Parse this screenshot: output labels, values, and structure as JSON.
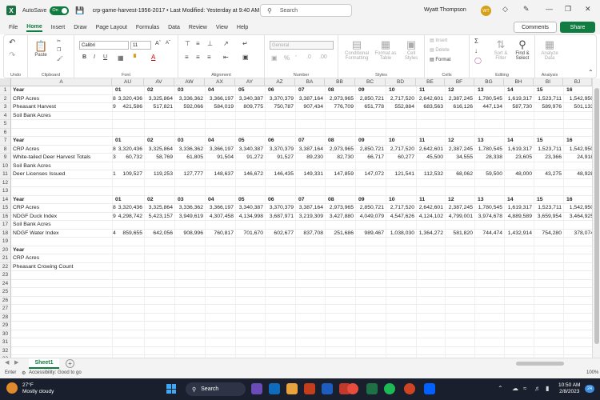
{
  "titlebar": {
    "app_icon": "excel-logo",
    "app_letter": "X",
    "autosave_label": "AutoSave",
    "autosave_state": "On",
    "doc_title": "crp-game-harvest-1956-2017 • Last Modified: Yesterday at 9:40 AM",
    "search_placeholder": "Search",
    "user_name": "Wyatt Thompson",
    "user_initials": "WT"
  },
  "menu_tabs": [
    "File",
    "Home",
    "Insert",
    "Draw",
    "Page Layout",
    "Formulas",
    "Data",
    "Review",
    "View",
    "Help"
  ],
  "active_tab": "Home",
  "comments_label": "Comments",
  "share_label": "Share",
  "ribbon": {
    "groups": [
      "Undo",
      "Clipboard",
      "Font",
      "Alignment",
      "Number",
      "Styles",
      "Cells",
      "Editing",
      "Analysis"
    ],
    "paste_label": "Paste",
    "font_name": "Calibri",
    "font_size": "11",
    "number_format": "General",
    "cond_format_label": "Conditional Formatting",
    "format_table_label": "Format as Table",
    "cell_styles_label": "Cell Styles",
    "insert_label": "Insert",
    "delete_label": "Delete",
    "format_label": "Format",
    "sort_filter_label": "Sort & Filter",
    "find_select_label": "Find & Select",
    "analyze_label": "Analyze Data"
  },
  "sheet": {
    "columns": [
      "A",
      "AU",
      "AV",
      "AW",
      "AX",
      "AY",
      "AZ",
      "BA",
      "BB",
      "BC",
      "BD",
      "BE",
      "BF",
      "BG",
      "BH",
      "BI",
      "BJ"
    ],
    "row_numbers": [
      "1",
      "2",
      "3",
      "4",
      "5",
      "6",
      "7",
      "8",
      "9",
      "10",
      "11",
      "12",
      "13",
      "14",
      "15",
      "16",
      "17",
      "18",
      "19",
      "20",
      "21",
      "22",
      "23",
      "24",
      "25",
      "26",
      "27",
      "28",
      "29",
      "30",
      "31",
      "32",
      "33"
    ],
    "rows": [
      {
        "label": "Year",
        "bold": true,
        "stub": "",
        "header": true,
        "values": [
          "01",
          "02",
          "03",
          "04",
          "05",
          "06",
          "07",
          "08",
          "09",
          "10",
          "11",
          "12",
          "13",
          "14",
          "15",
          "16"
        ]
      },
      {
        "label": "CRP Acres",
        "stub": "8",
        "values": [
          "3,320,436",
          "3,325,864",
          "3,336,362",
          "3,366,197",
          "3,340,387",
          "3,370,379",
          "3,387,164",
          "2,973,965",
          "2,850,721",
          "2,717,520",
          "2,642,601",
          "2,387,245",
          "1,780,545",
          "1,619,317",
          "1,523,711",
          "1,542,950"
        ]
      },
      {
        "label": "Pheasant Harvest",
        "stub": "9",
        "values": [
          "421,586",
          "517,821",
          "592,066",
          "584,019",
          "809,775",
          "750,787",
          "907,434",
          "776,709",
          "651,778",
          "552,884",
          "683,563",
          "616,126",
          "447,134",
          "587,730",
          "589,976",
          "501,133"
        ]
      },
      {
        "label": "Soil Bank Acres",
        "stub": "",
        "values": []
      },
      {
        "label": "",
        "stub": "",
        "values": []
      },
      {
        "label": "",
        "stub": "",
        "values": []
      },
      {
        "label": "Year",
        "bold": true,
        "stub": "",
        "header": true,
        "values": [
          "01",
          "02",
          "03",
          "04",
          "05",
          "06",
          "07",
          "08",
          "09",
          "10",
          "11",
          "12",
          "13",
          "14",
          "15",
          "16"
        ]
      },
      {
        "label": "CRP Acres",
        "stub": "8",
        "values": [
          "3,320,436",
          "3,325,864",
          "3,336,362",
          "3,366,197",
          "3,340,387",
          "3,370,379",
          "3,387,164",
          "2,973,965",
          "2,850,721",
          "2,717,520",
          "2,642,601",
          "2,387,245",
          "1,780,545",
          "1,619,317",
          "1,523,711",
          "1,542,950"
        ]
      },
      {
        "label": "White-tailed Deer Harvest Totals",
        "stub": "3",
        "values": [
          "60,732",
          "58,769",
          "61,805",
          "91,504",
          "91,272",
          "91,527",
          "89,230",
          "82,730",
          "66,717",
          "60,277",
          "45,500",
          "34,555",
          "28,338",
          "23,605",
          "23,366",
          "24,918"
        ]
      },
      {
        "label": "Soil Bank Acres",
        "stub": "",
        "values": []
      },
      {
        "label": "Deer Licenses Issued",
        "stub": "1",
        "values": [
          "109,527",
          "119,253",
          "127,777",
          "148,637",
          "146,672",
          "146,435",
          "149,331",
          "147,859",
          "147,072",
          "121,541",
          "112,532",
          "68,062",
          "59,500",
          "48,000",
          "43,275",
          "48,928"
        ]
      },
      {
        "label": "",
        "stub": "",
        "values": []
      },
      {
        "label": "",
        "stub": "",
        "values": []
      },
      {
        "label": "Year",
        "bold": true,
        "stub": "",
        "header": true,
        "values": [
          "01",
          "02",
          "03",
          "04",
          "05",
          "06",
          "07",
          "08",
          "09",
          "10",
          "11",
          "12",
          "13",
          "14",
          "15",
          "16"
        ]
      },
      {
        "label": "CRP Acres",
        "stub": "8",
        "values": [
          "3,320,436",
          "3,325,864",
          "3,336,362",
          "3,366,197",
          "3,340,387",
          "3,370,379",
          "3,387,164",
          "2,973,965",
          "2,850,721",
          "2,717,520",
          "2,642,601",
          "2,387,245",
          "1,780,545",
          "1,619,317",
          "1,523,711",
          "1,542,950"
        ]
      },
      {
        "label": "NDGF Duck Index",
        "stub": "9",
        "values": [
          "4,298,742",
          "5,423,157",
          "3,949,619",
          "4,307,458",
          "4,134,998",
          "3,687,971",
          "3,219,309",
          "3,427,880",
          "4,049,079",
          "4,547,626",
          "4,124,102",
          "4,799,001",
          "3,974,678",
          "4,889,589",
          "3,659,954",
          "3,464,925"
        ]
      },
      {
        "label": "Soil Bank Acres",
        "stub": "",
        "values": []
      },
      {
        "label": "NDGF Water Index",
        "stub": "4",
        "values": [
          "859,655",
          "642,056",
          "908,996",
          "760,817",
          "701,670",
          "602,677",
          "837,708",
          "251,686",
          "989,467",
          "1,038,030",
          "1,364,272",
          "581,820",
          "744,474",
          "1,432,914",
          "754,280",
          "378,074"
        ]
      },
      {
        "label": "",
        "stub": "",
        "values": []
      },
      {
        "label": "Year",
        "bold": true,
        "stub": "",
        "values": []
      },
      {
        "label": "CRP Acres",
        "stub": "",
        "values": []
      },
      {
        "label": "Pheasant Crowing Count",
        "stub": "",
        "values": []
      }
    ]
  },
  "sheet_tab": "Sheet1",
  "status": {
    "mode": "Enter",
    "accessibility": "Accessibility: Good to go",
    "zoom": "100%"
  },
  "taskbar": {
    "temperature": "27°F",
    "weather": "Mostly cloudy",
    "search_label": "Search",
    "time": "10:50 AM",
    "date": "2/8/2023",
    "notifications": "24"
  }
}
